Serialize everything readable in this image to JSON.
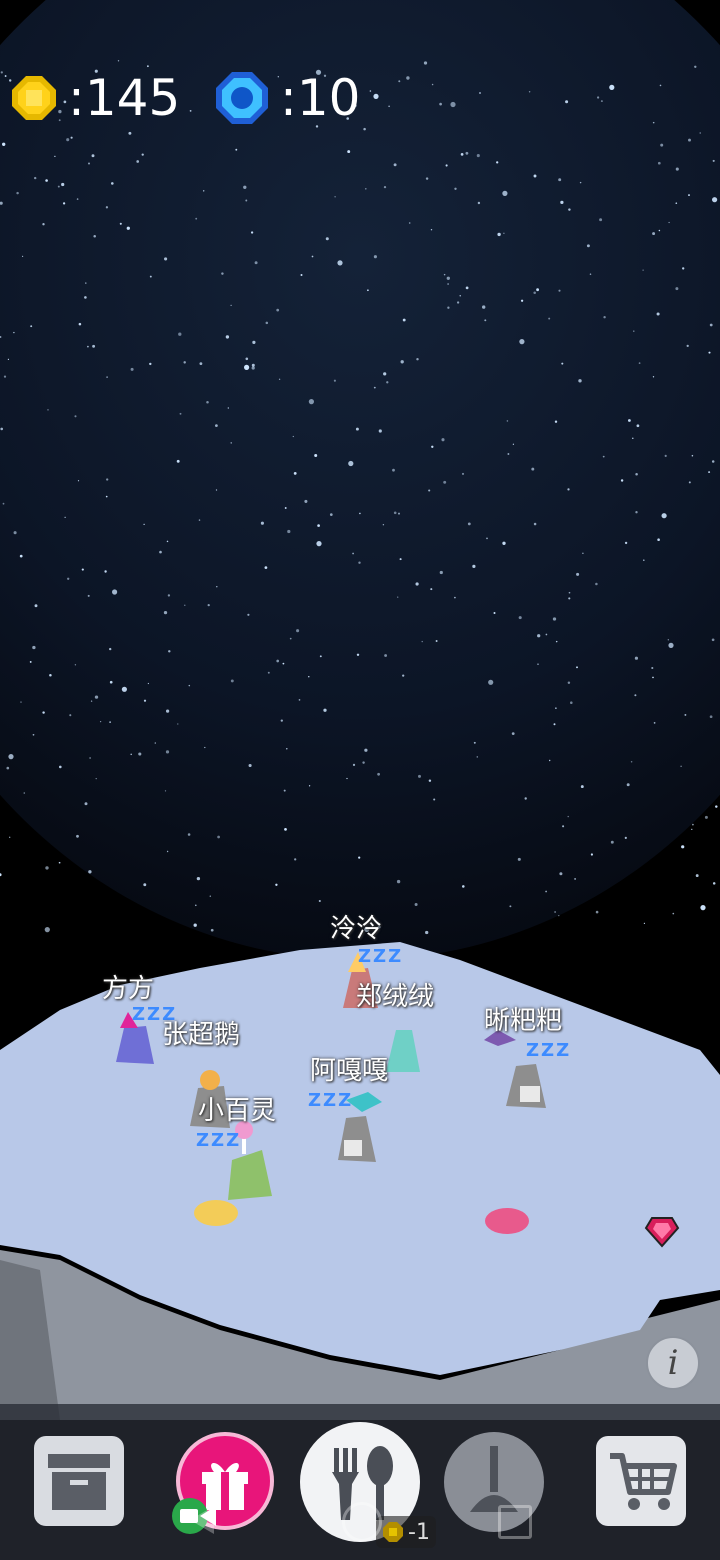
{
  "hud": {
    "coin_label": ":145",
    "gem_label": ":10",
    "coin_icon": "gold-coin-icon",
    "gem_icon": "blue-gem-icon"
  },
  "characters": [
    {
      "name": "泠泠",
      "zzz": "ZZZ",
      "color": "#c97a7a"
    },
    {
      "name": "方方",
      "zzz": "ZZZ",
      "color": "#6f6fd6"
    },
    {
      "name": "郑绒绒",
      "zzz": "",
      "color": "#6fd0c6"
    },
    {
      "name": "张超鹅",
      "zzz": "",
      "color": "#8e8e8e"
    },
    {
      "name": "晰粑粑",
      "zzz": "ZZZ",
      "color": "#8e8e8e"
    },
    {
      "name": "阿嘎嘎",
      "zzz": "ZZZ",
      "color": "#8e8e8e"
    },
    {
      "name": "小百灵",
      "zzz": "ZZZ",
      "color": "#8fc16b"
    }
  ],
  "toolbar": {
    "items": [
      {
        "icon": "storage-box-icon"
      },
      {
        "icon": "gift-icon"
      },
      {
        "icon": "fork-spoon-icon"
      },
      {
        "icon": "plunger-icon"
      },
      {
        "icon": "shopping-cart-icon"
      }
    ],
    "cost_label": "-1"
  },
  "info_label": "i",
  "colors": {
    "platform": "#b8c8e8",
    "gift": "#e8157a",
    "toolbar": "#2c3038"
  }
}
